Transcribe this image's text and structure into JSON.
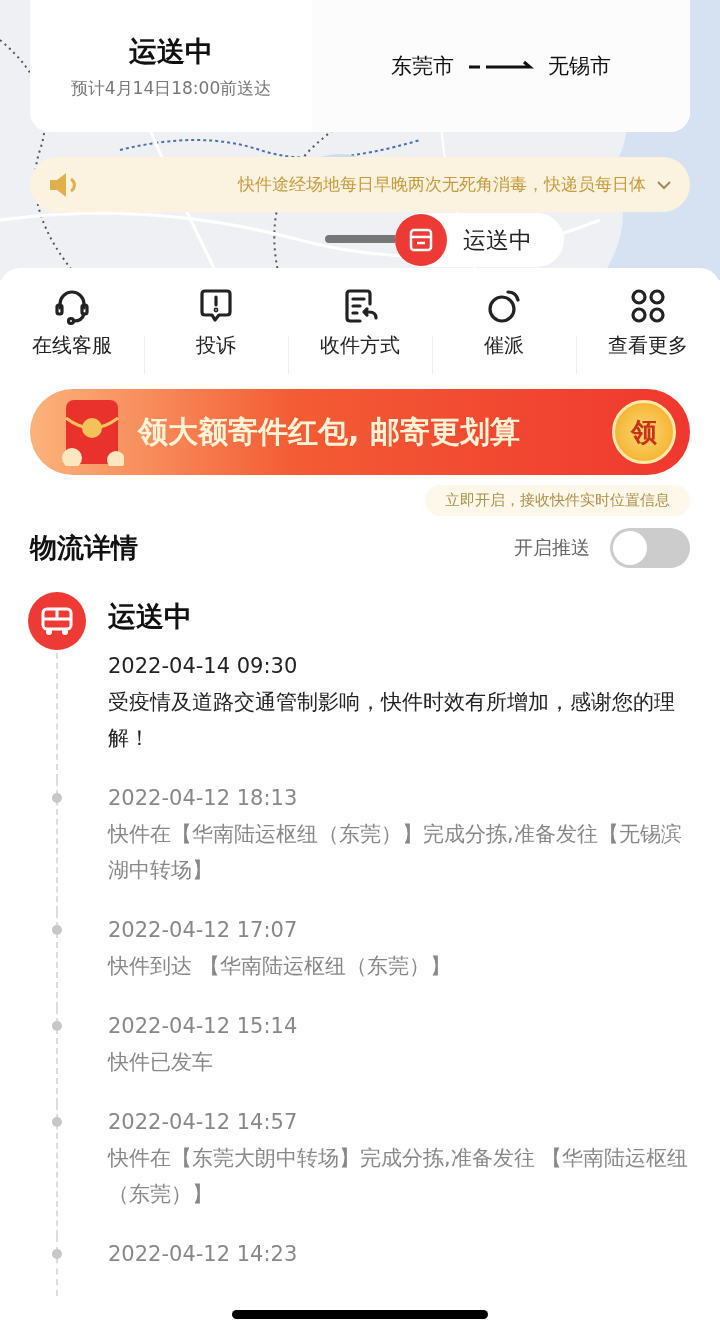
{
  "status_card": {
    "status": "运送中",
    "eta": "预计4月14日18:00前送达"
  },
  "route": {
    "from": "东莞市",
    "to": "无锡市"
  },
  "notice": {
    "text": "快件途经场地每日早晚两次无死角消毒，快递员每日体"
  },
  "map_marker": {
    "label": "运送中"
  },
  "actions": [
    {
      "label": "在线客服",
      "kind": "headset"
    },
    {
      "label": "投诉",
      "kind": "complaint"
    },
    {
      "label": "收件方式",
      "kind": "receive"
    },
    {
      "label": "催派",
      "kind": "urge"
    },
    {
      "label": "查看更多",
      "kind": "more"
    }
  ],
  "promo": {
    "text": "领大额寄件红包, 邮寄更划算",
    "button": "领"
  },
  "push_tip": "立即开启，接收快件实时位置信息",
  "section": {
    "title": "物流详情",
    "push_label": "开启推送",
    "push_on": false
  },
  "timeline": [
    {
      "current": true,
      "status": "运送中",
      "time": "2022-04-14 09:30",
      "text": "受疫情及道路交通管制影响，快件时效有所增加，感谢您的理解！"
    },
    {
      "current": false,
      "time": "2022-04-12 18:13",
      "text": "快件在【华南陆运枢纽（东莞）】完成分拣,准备发往【无锡滨湖中转场】"
    },
    {
      "current": false,
      "time": "2022-04-12 17:07",
      "text": "快件到达 【华南陆运枢纽（东莞）】"
    },
    {
      "current": false,
      "time": "2022-04-12 15:14",
      "text": "快件已发车"
    },
    {
      "current": false,
      "time": "2022-04-12 14:57",
      "text": "快件在【东莞大朗中转场】完成分拣,准备发往 【华南陆运枢纽（东莞）】"
    },
    {
      "current": false,
      "time": "2022-04-12 14:23"
    }
  ]
}
